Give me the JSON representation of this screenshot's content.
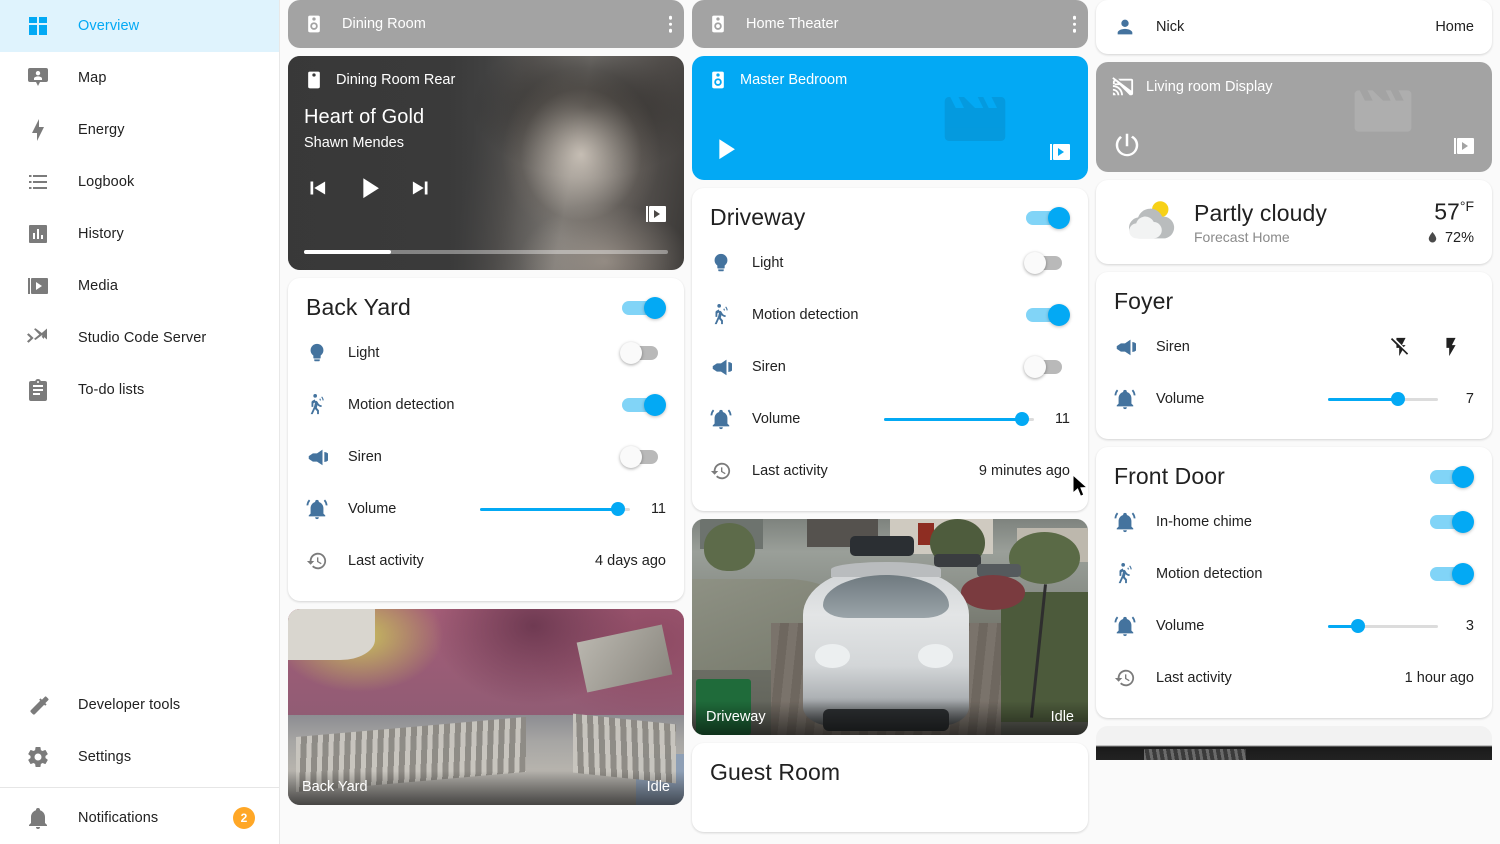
{
  "sidebar": {
    "items": [
      {
        "label": "Overview",
        "icon": "view-dashboard-icon",
        "active": true
      },
      {
        "label": "Map",
        "icon": "map-marker-account-icon",
        "active": false
      },
      {
        "label": "Energy",
        "icon": "lightning-bolt-icon",
        "active": false
      },
      {
        "label": "Logbook",
        "icon": "format-list-bulleted-icon",
        "active": false
      },
      {
        "label": "History",
        "icon": "chart-box-icon",
        "active": false
      },
      {
        "label": "Media",
        "icon": "play-box-multiple-icon",
        "active": false
      },
      {
        "label": "Studio Code Server",
        "icon": "vscode-icon",
        "active": false
      },
      {
        "label": "To-do lists",
        "icon": "clipboard-list-icon",
        "active": false
      }
    ],
    "bottom_items": [
      {
        "label": "Developer tools",
        "icon": "hammer-icon"
      },
      {
        "label": "Settings",
        "icon": "cog-icon"
      }
    ],
    "notifications": {
      "label": "Notifications",
      "icon": "bell-icon",
      "count": "2"
    }
  },
  "column_left": {
    "media_dining_room": {
      "name": "Dining Room",
      "icon": "speaker-icon",
      "state": "idle"
    },
    "media_dining_rear": {
      "name": "Dining Room Rear",
      "icon": "speaker-pause-icon",
      "title": "Heart of Gold",
      "artist": "Shawn Mendes",
      "progress_percent": 24,
      "controls": [
        "previous-track-icon",
        "play-icon",
        "next-track-icon"
      ],
      "browse_icon": "play-box-multiple-icon"
    },
    "back_yard": {
      "title": "Back Yard",
      "main_toggle": true,
      "rows": [
        {
          "icon": "lightbulb-icon",
          "name": "Light",
          "type": "toggle",
          "on": false
        },
        {
          "icon": "motion-sensor-icon",
          "name": "Motion detection",
          "type": "toggle",
          "on": true
        },
        {
          "icon": "bullhorn-icon",
          "name": "Siren",
          "type": "toggle",
          "on": false
        },
        {
          "icon": "bell-ring-icon",
          "name": "Volume",
          "type": "slider",
          "value": "11",
          "percent": 92
        },
        {
          "icon": "history-icon",
          "name": "Last activity",
          "type": "text",
          "value": "4 days ago"
        }
      ]
    },
    "camera_back_yard": {
      "name": "Back Yard",
      "status": "Idle"
    }
  },
  "column_middle": {
    "media_home_theater": {
      "name": "Home Theater",
      "icon": "speaker-icon",
      "state": "idle"
    },
    "media_master_bedroom": {
      "name": "Master Bedroom",
      "icon": "speaker-icon",
      "play_icon": "play-icon",
      "browse_icon": "play-box-multiple-icon"
    },
    "driveway": {
      "title": "Driveway",
      "main_toggle": true,
      "rows": [
        {
          "icon": "lightbulb-icon",
          "name": "Light",
          "type": "toggle",
          "on": false
        },
        {
          "icon": "motion-sensor-icon",
          "name": "Motion detection",
          "type": "toggle",
          "on": true
        },
        {
          "icon": "bullhorn-icon",
          "name": "Siren",
          "type": "toggle",
          "on": false
        },
        {
          "icon": "bell-ring-icon",
          "name": "Volume",
          "type": "slider",
          "value": "11",
          "percent": 92
        },
        {
          "icon": "history-icon",
          "name": "Last activity",
          "type": "text",
          "value": "9 minutes ago"
        }
      ]
    },
    "camera_driveway": {
      "name": "Driveway",
      "status": "Idle"
    },
    "guest_room": {
      "title": "Guest Room"
    }
  },
  "column_right": {
    "person": {
      "icon": "account-icon",
      "name": "Nick",
      "state": "Home"
    },
    "media_living_room_display": {
      "name": "Living room Display",
      "icon": "cast-off-icon",
      "power_icon": "power-icon",
      "browse_icon": "play-box-multiple-icon"
    },
    "weather": {
      "condition": "Partly cloudy",
      "location": "Forecast Home",
      "temperature": "57",
      "temperature_unit": "°F",
      "humidity": "72%",
      "humidity_icon": "water-percent-icon",
      "weather_icon": "partly-cloudy-icon"
    },
    "foyer": {
      "title": "Foyer",
      "rows": [
        {
          "icon": "bullhorn-icon",
          "name": "Siren",
          "type": "icon-actions",
          "actions": [
            "flash-off-icon",
            "flash-icon"
          ]
        },
        {
          "icon": "bell-ring-icon",
          "name": "Volume",
          "type": "slider",
          "value": "7",
          "percent": 64
        }
      ]
    },
    "front_door": {
      "title": "Front Door",
      "main_toggle": true,
      "rows": [
        {
          "icon": "bell-ring-icon",
          "name": "In-home chime",
          "type": "toggle",
          "on": true
        },
        {
          "icon": "motion-sensor-icon",
          "name": "Motion detection",
          "type": "toggle",
          "on": true
        },
        {
          "icon": "bell-ring-icon",
          "name": "Volume",
          "type": "slider",
          "value": "3",
          "percent": 27
        },
        {
          "icon": "history-icon",
          "name": "Last activity",
          "type": "text",
          "value": "1 hour ago"
        }
      ]
    }
  },
  "colors": {
    "accent": "#03a9f4",
    "accent_track": "#81d4f7",
    "icon_blue": "#44739e",
    "sidebar_active_bg": "#dff3fd",
    "badge_orange": "#ffa726",
    "text_primary": "#212121",
    "text_secondary": "#8a8a8a",
    "card_bg": "#ffffff",
    "page_bg": "#fafafa"
  }
}
